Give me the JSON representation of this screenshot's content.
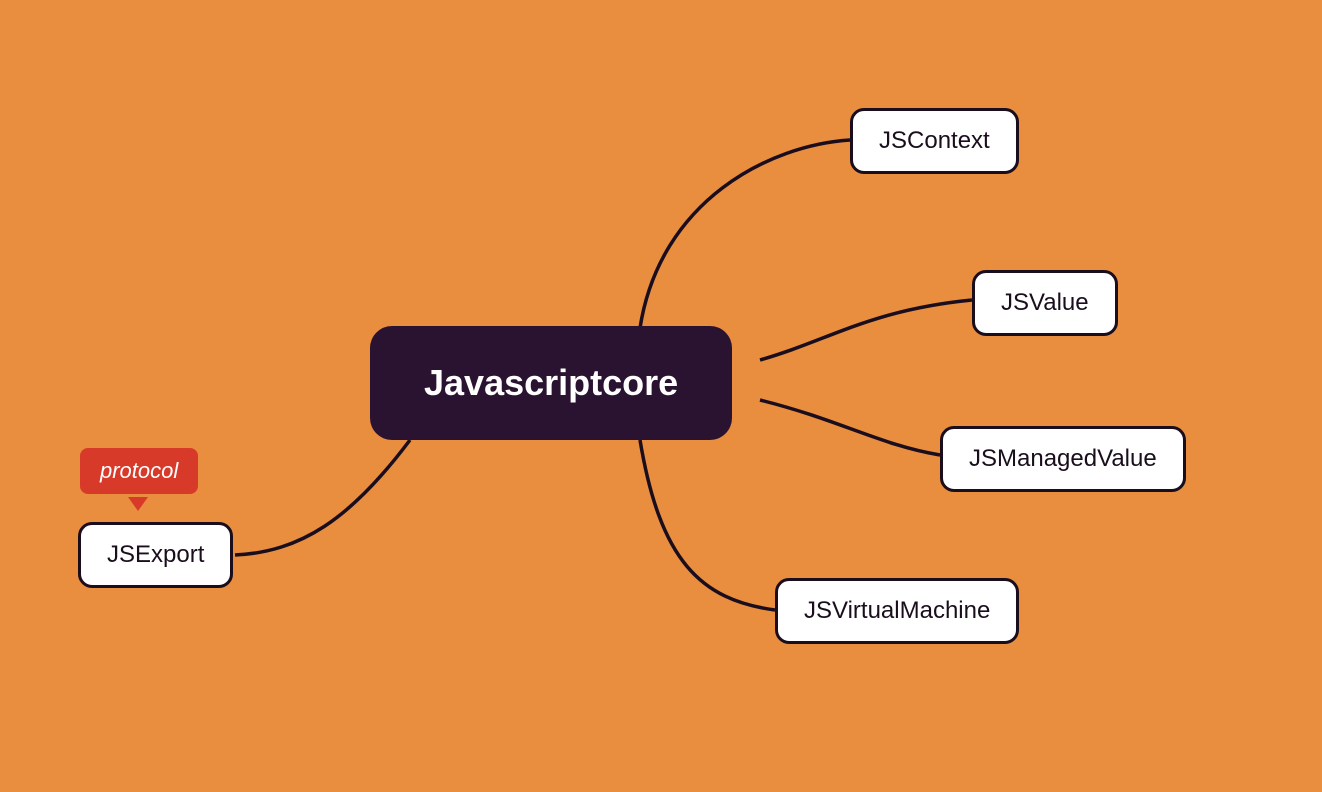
{
  "diagram": {
    "center": {
      "label": "Javascriptcore"
    },
    "badge": {
      "label": "protocol"
    },
    "nodes": {
      "jscontext": {
        "label": "JSContext"
      },
      "jsvalue": {
        "label": "JSValue"
      },
      "jsmanagedvalue": {
        "label": "JSManagedValue"
      },
      "jsvirtualmachine": {
        "label": "JSVirtualMachine"
      },
      "jsexport": {
        "label": "JSExport"
      }
    }
  },
  "colors": {
    "background": "#e98d3f",
    "center_bg": "#2a1330",
    "node_bg": "#ffffff",
    "border": "#1a0e1d",
    "badge_bg": "#d83a2a"
  }
}
